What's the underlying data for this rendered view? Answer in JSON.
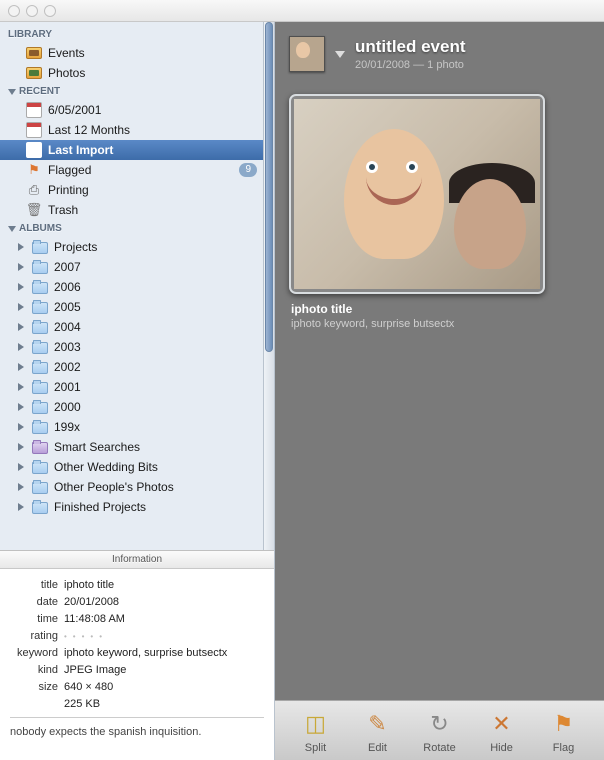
{
  "sidebar": {
    "sections": {
      "library": {
        "label": "LIBRARY",
        "items": [
          {
            "label": "Events"
          },
          {
            "label": "Photos"
          }
        ]
      },
      "recent": {
        "label": "RECENT",
        "items": [
          {
            "label": "6/05/2001"
          },
          {
            "label": "Last 12 Months"
          },
          {
            "label": "Last Import"
          },
          {
            "label": "Flagged",
            "badge": "9"
          },
          {
            "label": "Printing"
          },
          {
            "label": "Trash"
          }
        ]
      },
      "albums": {
        "label": "ALBUMS",
        "items": [
          {
            "label": "Projects"
          },
          {
            "label": "2007"
          },
          {
            "label": "2006"
          },
          {
            "label": "2005"
          },
          {
            "label": "2004"
          },
          {
            "label": "2003"
          },
          {
            "label": "2002"
          },
          {
            "label": "2001"
          },
          {
            "label": "2000"
          },
          {
            "label": "199x"
          },
          {
            "label": "Smart Searches"
          },
          {
            "label": "Other Wedding Bits"
          },
          {
            "label": "Other People's Photos"
          },
          {
            "label": "Finished Projects"
          }
        ]
      }
    }
  },
  "info": {
    "tab": "Information",
    "labels": {
      "title": "title",
      "date": "date",
      "time": "time",
      "rating": "rating",
      "keyword": "keyword",
      "kind": "kind",
      "size": "size"
    },
    "values": {
      "title": "iphoto title",
      "date": "20/01/2008",
      "time": "11:48:08 AM",
      "keyword": "iphoto keyword, surprise butsectx",
      "kind": "JPEG Image",
      "size_dims": "640 × 480",
      "size_bytes": "225 KB"
    },
    "caption": "nobody expects the spanish inquisition."
  },
  "event": {
    "title": "untitled event",
    "meta": "20/01/2008 — 1 photo"
  },
  "photo": {
    "title": "iphoto title",
    "subtitle": "iphoto keyword, surprise butsectx"
  },
  "toolbar": {
    "split": "Split",
    "edit": "Edit",
    "rotate": "Rotate",
    "hide": "Hide",
    "flag": "Flag"
  }
}
